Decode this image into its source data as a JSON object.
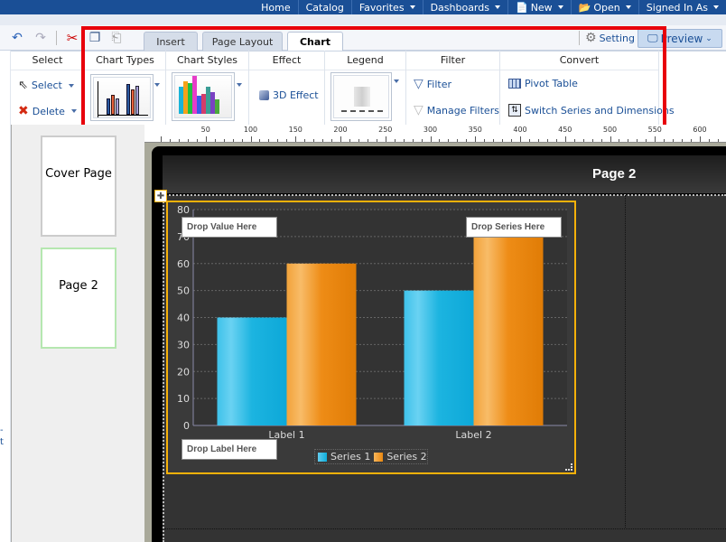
{
  "topnav": {
    "items": [
      {
        "label": "Home",
        "icon": null,
        "dropdown": false
      },
      {
        "label": "Catalog",
        "icon": null,
        "dropdown": false
      },
      {
        "label": "Favorites",
        "icon": null,
        "dropdown": true
      },
      {
        "label": "Dashboards",
        "icon": null,
        "dropdown": true
      },
      {
        "label": "New",
        "icon": "new-document-icon",
        "dropdown": true
      },
      {
        "label": "Open",
        "icon": "folder-icon",
        "dropdown": true
      },
      {
        "label": "Signed In As",
        "icon": null,
        "dropdown": true
      }
    ]
  },
  "toolbar": {
    "icons": [
      "undo-icon",
      "redo-icon",
      "cut-icon",
      "copy-icon",
      "paste-icon"
    ],
    "tabs": [
      {
        "label": "Insert",
        "active": false
      },
      {
        "label": "Page Layout",
        "active": false
      },
      {
        "label": "Chart",
        "active": true
      }
    ],
    "setting_label": "Setting",
    "preview_label": "Preview"
  },
  "ribbon": {
    "select_group": {
      "title": "Select",
      "select_label": "Select",
      "delete_label": "Delete"
    },
    "chart_types": {
      "title": "Chart Types"
    },
    "chart_styles": {
      "title": "Chart Styles"
    },
    "effect": {
      "title": "Effect",
      "button": "3D Effect"
    },
    "legend": {
      "title": "Legend"
    },
    "filter": {
      "title": "Filter",
      "filter_label": "Filter",
      "manage_label": "Manage Filters"
    },
    "convert": {
      "title": "Convert",
      "pivot_label": "Pivot Table",
      "switch_label": "Switch Series and Dimensions"
    }
  },
  "sidebar": {
    "pages": [
      {
        "label": "Cover Page",
        "selected": false
      },
      {
        "label": "Page 2",
        "selected": true
      }
    ]
  },
  "ruler": {
    "labels": [
      "50",
      "100",
      "150",
      "200",
      "250",
      "300",
      "350",
      "400",
      "450",
      "500",
      "550",
      "600"
    ]
  },
  "page": {
    "title": "Page 2"
  },
  "chart": {
    "drop_value": "Drop Value Here",
    "drop_series": "Drop Series Here",
    "drop_label": "Drop Label Here"
  },
  "colors": {
    "nav_bg": "#1a4f96",
    "highlight_red": "#e8000b",
    "selection_orange": "#f6b10a",
    "series1": "#1fb3e0",
    "series2": "#f08c17"
  },
  "chart_data": {
    "type": "bar",
    "categories": [
      "Label 1",
      "Label 2"
    ],
    "series": [
      {
        "name": "Series 1",
        "values": [
          40,
          50
        ]
      },
      {
        "name": "Series 2",
        "values": [
          60,
          70
        ]
      }
    ],
    "title": "",
    "xlabel": "",
    "ylabel": "",
    "ylim": [
      0,
      80
    ],
    "yticks": [
      0,
      10,
      20,
      30,
      40,
      50,
      60,
      70,
      80
    ],
    "grid": true,
    "legend": "bottom-center"
  }
}
